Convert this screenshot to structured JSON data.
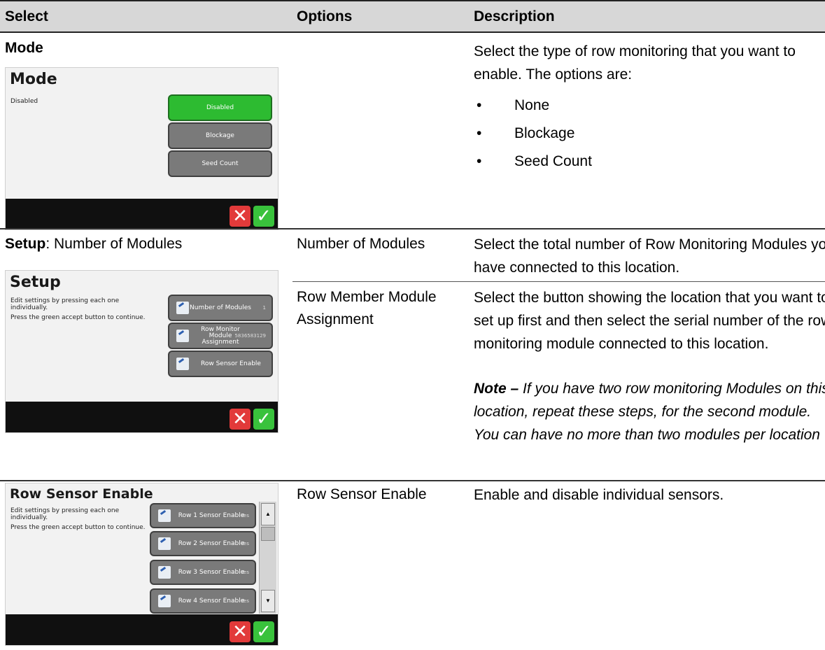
{
  "table": {
    "headers": [
      "Select",
      "Options",
      "Description"
    ],
    "rows": [
      {
        "select_bold": "Mode",
        "select_rest": "",
        "option": "",
        "description": "Select the type of row monitoring that you want to enable. The options are:",
        "bullets": [
          "None",
          "Blockage",
          "Seed Count"
        ]
      },
      {
        "select_bold": "Setup",
        "select_rest": ": Number of Modules",
        "option": "Number of Modules",
        "description": "Select the total number of Row Monitoring Modules you have connected to this location."
      },
      {
        "option": "Row Member Module Assignment",
        "description": "Select the button showing the location that you want to set up first and then select the serial number of the row monitoring module connected to this location.",
        "note_label": "Note –",
        "note_text": "If you have two row monitoring Modules on this location, repeat these steps, for the second module. You can have no more than two modules per location"
      },
      {
        "option": "Row Sensor Enable",
        "description": "Enable and disable individual sensors."
      }
    ]
  },
  "screens": {
    "mode": {
      "title": "Mode",
      "current": "Disabled",
      "buttons": [
        "Disabled",
        "Blockage",
        "Seed Count"
      ],
      "selected_index": 0
    },
    "setup": {
      "title": "Setup",
      "instruction_1": "Edit settings by pressing each one individually.",
      "instruction_2": "Press the green accept button to continue.",
      "buttons": [
        {
          "label": "Number of Modules",
          "value": "1"
        },
        {
          "label": "Row Monitor Module Assignment",
          "value": "5836583129"
        },
        {
          "label": "Row Sensor Enable",
          "value": ""
        }
      ]
    },
    "row_sensor": {
      "title": "Row Sensor Enable",
      "instruction_1": "Edit settings by pressing each one individually.",
      "instruction_2": "Press the green accept button to continue.",
      "buttons": [
        {
          "label": "Row 1 Sensor Enable",
          "value": "Yes"
        },
        {
          "label": "Row 2 Sensor Enable",
          "value": "Yes"
        },
        {
          "label": "Row 3 Sensor Enable",
          "value": "Yes"
        },
        {
          "label": "Row 4 Sensor Enable",
          "value": "Yes"
        }
      ]
    },
    "cancel_icon": "close-icon",
    "accept_icon": "check-icon",
    "colors": {
      "selected": "#2dbb31",
      "button": "#7a7a7a",
      "bar": "#101010",
      "cancel": "#e23a3a",
      "accept": "#39c23c"
    }
  }
}
